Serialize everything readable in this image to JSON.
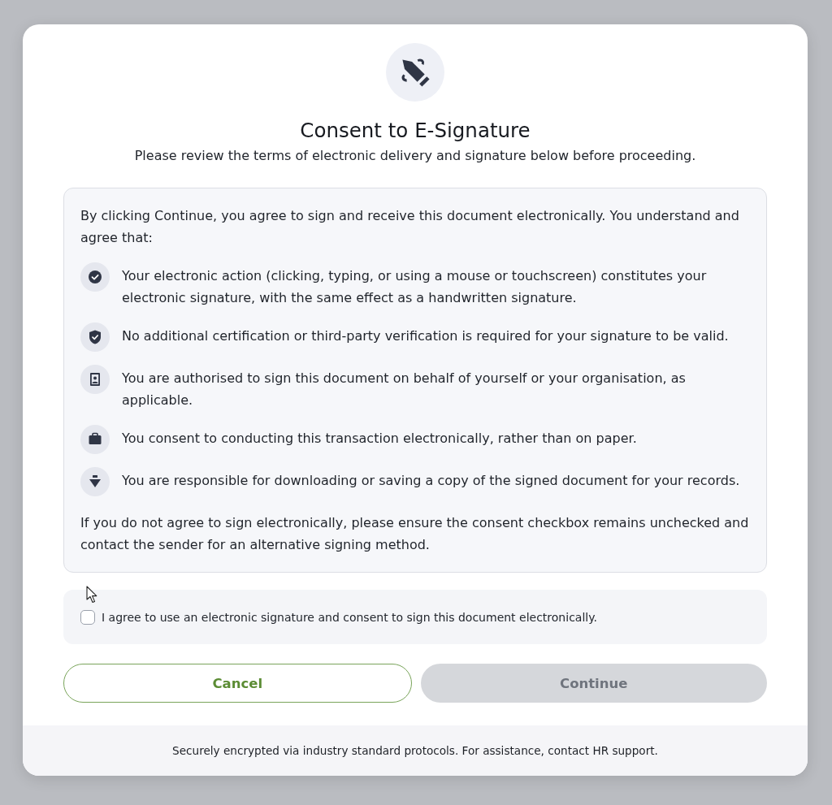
{
  "dialog": {
    "title": "Consent to E-Signature",
    "subtitle": "Please review the terms of electronic delivery and signature below before proceeding."
  },
  "terms": {
    "intro": "By clicking Continue, you agree to sign and receive this document electronically. You understand and agree that:",
    "items": [
      {
        "kind": "check",
        "text": "Your electronic action (clicking, typing, or using a mouse or touchscreen) constitutes your electronic signature, with the same effect as a handwritten signature."
      },
      {
        "kind": "shield",
        "text": "No additional certification or third-party verification is required for your signature to be valid."
      },
      {
        "kind": "badge",
        "text": "You are authorised to sign this document on behalf of yourself or your organisation, as applicable."
      },
      {
        "kind": "briefcase",
        "text": "You consent to conducting this transaction electronically, rather than on paper."
      },
      {
        "kind": "download",
        "text": "You are responsible for downloading or saving a copy of the signed document for your records."
      }
    ],
    "closing": "If you do not agree to sign electronically, please ensure the consent checkbox remains unchecked and contact the sender for an alternative signing method."
  },
  "consent": {
    "label": "I agree to use an electronic signature and consent to sign this document electronically.",
    "checked": false
  },
  "buttons": [
    {
      "kind": "secondary",
      "label": "Cancel",
      "disabled": false
    },
    {
      "kind": "primary",
      "label": "Continue",
      "disabled": true
    }
  ],
  "footer": "Securely encrypted via industry standard protocols. For assistance, contact HR support."
}
